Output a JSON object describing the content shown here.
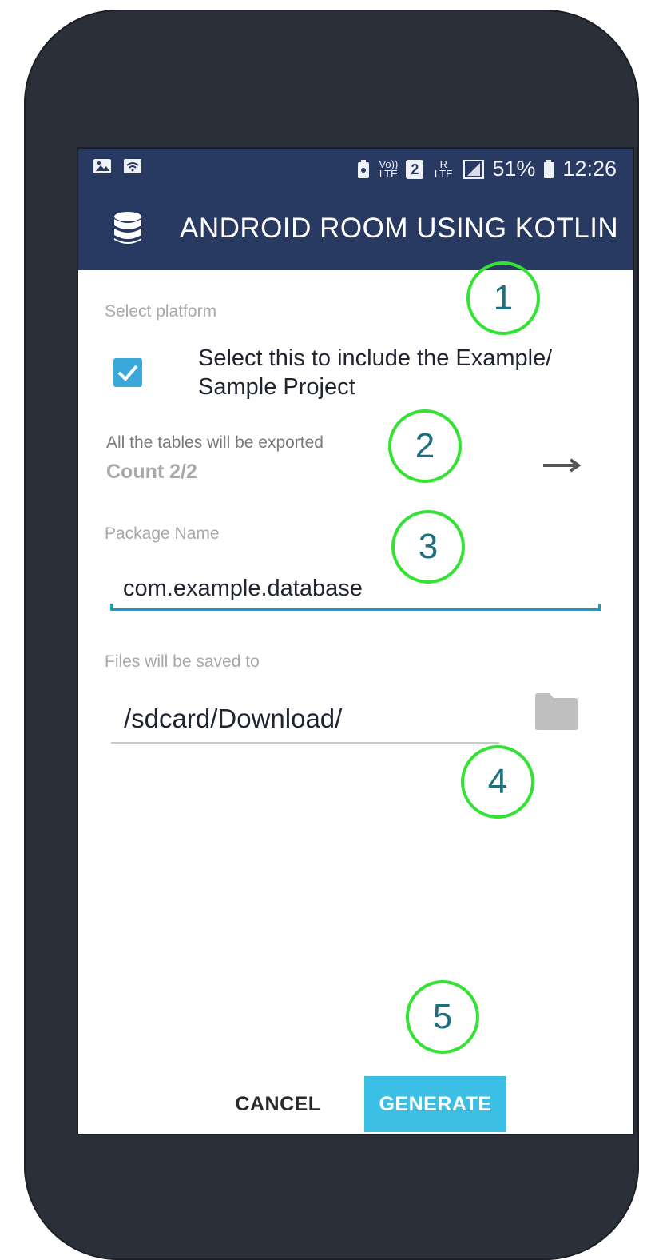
{
  "status_bar": {
    "volte": "Vo)) LTE",
    "sim": "2",
    "network": "R LTE",
    "battery": "51%",
    "time": "12:26"
  },
  "toolbar": {
    "title": "ANDROID ROOM USING KOTLIN",
    "icon": "database-icon"
  },
  "form": {
    "select_platform_label": "Select platform",
    "include_sample_text": "Select this to include the Example/ Sample Project",
    "include_sample_checked": true,
    "tables_export_text": "All the tables will be exported",
    "count_text": "Count 2/2",
    "package_label": "Package Name",
    "package_value": "com.example.database",
    "save_label": "Files will be saved to",
    "save_path": "/sdcard/Download/"
  },
  "buttons": {
    "cancel": "CANCEL",
    "generate": "GENERATE"
  },
  "markers": [
    "1",
    "2",
    "3",
    "4",
    "5"
  ],
  "colors": {
    "toolbar_bg": "#283962",
    "accent": "#3bbfe4",
    "marker": "#33e233"
  }
}
